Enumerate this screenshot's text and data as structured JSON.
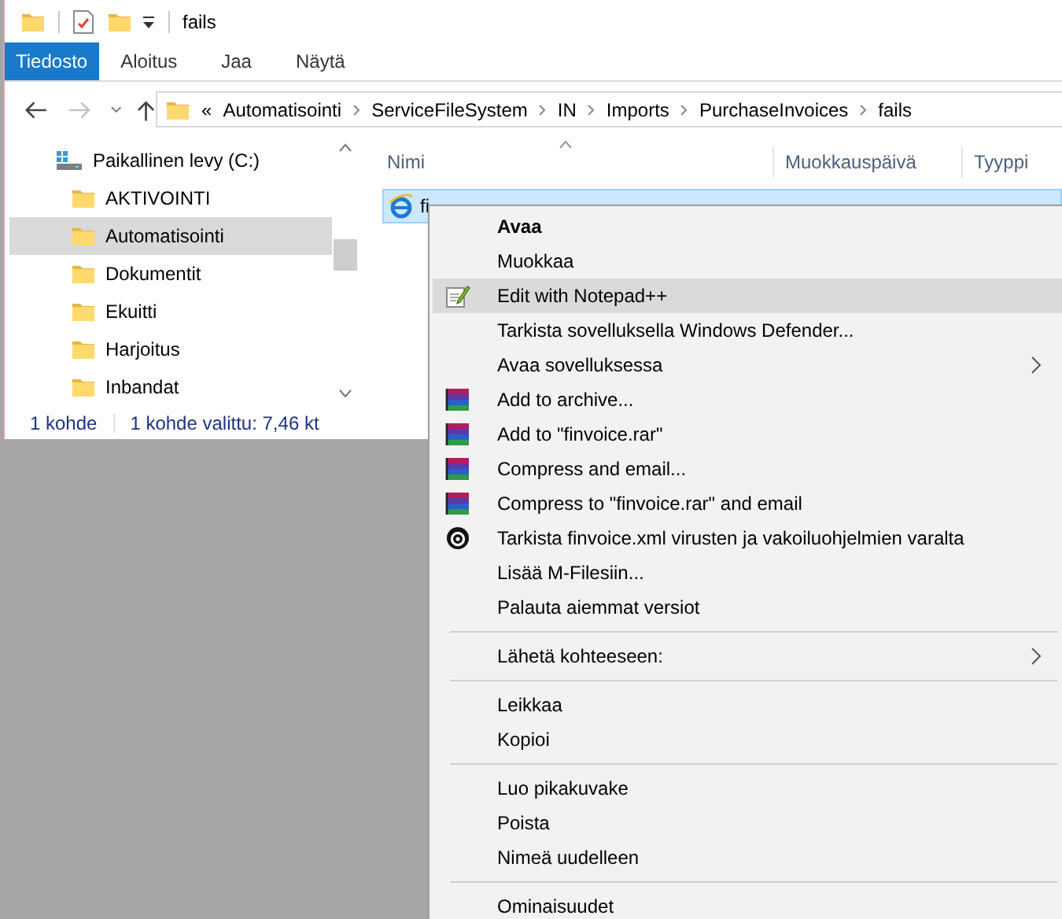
{
  "window": {
    "title": "fails"
  },
  "ribbon_tabs": [
    {
      "label": "Tiedosto",
      "kind": "file"
    },
    {
      "label": "Aloitus",
      "kind": "tab"
    },
    {
      "label": "Jaa",
      "kind": "tab"
    },
    {
      "label": "Näytä",
      "kind": "tab"
    }
  ],
  "address": {
    "overflow": "«",
    "path": [
      "Automatisointi",
      "ServiceFileSystem",
      "IN",
      "Imports",
      "PurchaseInvoices",
      "fails"
    ]
  },
  "navigation": {
    "tree": [
      {
        "label": "Paikallinen levy (C:)",
        "kind": "drive",
        "selected": false,
        "children": [
          {
            "label": "AKTIVOINTI",
            "kind": "folder",
            "selected": false
          },
          {
            "label": "Automatisointi",
            "kind": "folder",
            "selected": true
          },
          {
            "label": "Dokumentit",
            "kind": "folder",
            "selected": false
          },
          {
            "label": "Ekuitti",
            "kind": "folder",
            "selected": false
          },
          {
            "label": "Harjoitus",
            "kind": "folder",
            "selected": false
          },
          {
            "label": "Inbandat",
            "kind": "folder",
            "selected": false
          }
        ]
      }
    ]
  },
  "table": {
    "columns": [
      "Nimi",
      "Muokkauspäivä",
      "Tyyppi"
    ],
    "rows": [
      {
        "name": "fi",
        "selected": true
      }
    ]
  },
  "status_bar": {
    "count": "1 kohde",
    "selection": "1 kohde valittu: 7,46 kt"
  },
  "context_menu": {
    "items": [
      {
        "kind": "plain",
        "label": "Avaa",
        "default": true,
        "selected": false,
        "submenu": false
      },
      {
        "kind": "plain",
        "label": "Muokkaa",
        "default": false,
        "selected": false,
        "submenu": false
      },
      {
        "kind": "notepad",
        "label": "Edit with Notepad++",
        "default": false,
        "selected": true,
        "submenu": false
      },
      {
        "kind": "plain",
        "label": "Tarkista sovelluksella Windows Defender...",
        "default": false,
        "selected": false,
        "submenu": false
      },
      {
        "kind": "plain",
        "label": "Avaa sovelluksessa",
        "default": false,
        "selected": false,
        "submenu": true
      },
      {
        "kind": "archive",
        "label": "Add to archive...",
        "default": false,
        "selected": false,
        "submenu": false
      },
      {
        "kind": "archive",
        "label": "Add to \"finvoice.rar\"",
        "default": false,
        "selected": false,
        "submenu": false
      },
      {
        "kind": "archive",
        "label": "Compress and email...",
        "default": false,
        "selected": false,
        "submenu": false
      },
      {
        "kind": "archive",
        "label": "Compress to \"finvoice.rar\" and email",
        "default": false,
        "selected": false,
        "submenu": false
      },
      {
        "kind": "scan",
        "label": "Tarkista finvoice.xml virusten ja vakoiluohjelmien varalta",
        "default": false,
        "selected": false,
        "submenu": false
      },
      {
        "kind": "plain",
        "label": "Lisää M-Filesiin...",
        "default": false,
        "selected": false,
        "submenu": false
      },
      {
        "kind": "plain",
        "label": "Palauta aiemmat versiot",
        "default": false,
        "selected": false,
        "submenu": false
      },
      {
        "kind": "separator"
      },
      {
        "kind": "plain",
        "label": "Lähetä kohteeseen:",
        "default": false,
        "selected": false,
        "submenu": true
      },
      {
        "kind": "separator"
      },
      {
        "kind": "plain",
        "label": "Leikkaa",
        "default": false,
        "selected": false,
        "submenu": false
      },
      {
        "kind": "plain",
        "label": "Kopioi",
        "default": false,
        "selected": false,
        "submenu": false
      },
      {
        "kind": "separator"
      },
      {
        "kind": "plain",
        "label": "Luo pikakuvake",
        "default": false,
        "selected": false,
        "submenu": false
      },
      {
        "kind": "plain",
        "label": "Poista",
        "default": false,
        "selected": false,
        "submenu": false
      },
      {
        "kind": "plain",
        "label": "Nimeä uudelleen",
        "default": false,
        "selected": false,
        "submenu": false
      },
      {
        "kind": "separator"
      },
      {
        "kind": "plain",
        "label": "Ominaisuudet",
        "default": false,
        "selected": false,
        "submenu": false
      }
    ]
  }
}
